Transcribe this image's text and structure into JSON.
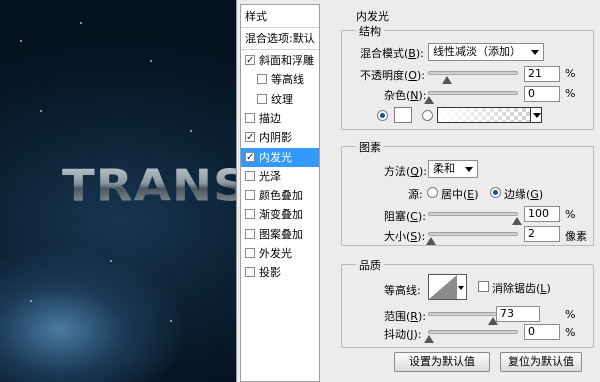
{
  "background": {
    "text": "TRANS"
  },
  "style_list": {
    "header": "样式",
    "blend_options": "混合选项:默认",
    "items": [
      {
        "label": "斜面和浮雕",
        "checked": true,
        "selected": false,
        "indent": false
      },
      {
        "label": "等高线",
        "checked": false,
        "selected": false,
        "indent": true
      },
      {
        "label": "纹理",
        "checked": false,
        "selected": false,
        "indent": true
      },
      {
        "label": "描边",
        "checked": false,
        "selected": false,
        "indent": false
      },
      {
        "label": "内阴影",
        "checked": true,
        "selected": false,
        "indent": false
      },
      {
        "label": "内发光",
        "checked": true,
        "selected": true,
        "indent": false
      },
      {
        "label": "光泽",
        "checked": false,
        "selected": false,
        "indent": false
      },
      {
        "label": "颜色叠加",
        "checked": false,
        "selected": false,
        "indent": false
      },
      {
        "label": "渐变叠加",
        "checked": false,
        "selected": false,
        "indent": false
      },
      {
        "label": "图案叠加",
        "checked": false,
        "selected": false,
        "indent": false
      },
      {
        "label": "外发光",
        "checked": false,
        "selected": false,
        "indent": false
      },
      {
        "label": "投影",
        "checked": false,
        "selected": false,
        "indent": false
      }
    ]
  },
  "panel": {
    "title": "内发光",
    "structure": {
      "title": "结构",
      "blend_mode_label": "混合模式(",
      "blend_mode_key": "B",
      "blend_mode_suffix": "):",
      "blend_mode_value": "线性减淡（添加）",
      "opacity_label": "不透明度(",
      "opacity_key": "O",
      "opacity_suffix": "):",
      "opacity_value": "21",
      "opacity_unit": "%",
      "opacity_fraction": 0.21,
      "noise_label": "杂色(",
      "noise_key": "N",
      "noise_suffix": "):",
      "noise_value": "0",
      "noise_unit": "%",
      "noise_fraction": 0.0
    },
    "elements": {
      "title": "图素",
      "technique_label": "方法(",
      "technique_key": "Q",
      "technique_suffix": "):",
      "technique_value": "柔和",
      "source_label": "源:",
      "source_center": "居中(",
      "source_center_key": "E",
      "source_center_suffix": ")",
      "source_edge": "边缘(",
      "source_edge_key": "G",
      "source_edge_suffix": ")",
      "choke_label": "阻塞(",
      "choke_key": "C",
      "choke_suffix": "):",
      "choke_value": "100",
      "choke_unit": "%",
      "choke_fraction": 1.0,
      "size_label": "大小(",
      "size_key": "S",
      "size_suffix": "):",
      "size_value": "2",
      "size_unit": "像素",
      "size_fraction": 0.02
    },
    "quality": {
      "title": "品质",
      "contour_label": "等高线:",
      "antialias_label": "消除锯齿(",
      "antialias_key": "L",
      "antialias_suffix": ")",
      "range_label": "范围(",
      "range_key": "R",
      "range_suffix": "):",
      "range_value": "73",
      "range_unit": "%",
      "range_fraction": 0.73,
      "jitter_label": "抖动(",
      "jitter_key": "J",
      "jitter_suffix": "):",
      "jitter_value": "0",
      "jitter_unit": "%",
      "jitter_fraction": 0.0
    },
    "buttons": {
      "make_default": "设置为默认值",
      "reset_default": "复位为默认值"
    }
  }
}
